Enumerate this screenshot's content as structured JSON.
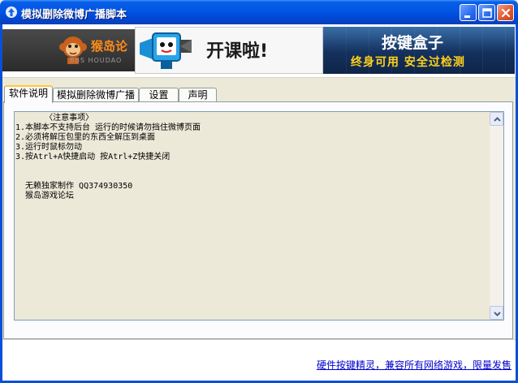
{
  "window": {
    "title": "模拟删除微博广播脚本",
    "icon": "arrow-up-icon",
    "controls": {
      "minimize": "minimize-icon",
      "maximize": "maximize-icon",
      "close": "close-icon"
    }
  },
  "banner": {
    "logo_text": "猴岛论",
    "logo_sub": "BBS HOUDAO",
    "ad_headline": "开课啦!",
    "ad_brand": "按键盒子",
    "ad_tagline": "终身可用  安全过检测"
  },
  "tabs": [
    {
      "label": "软件说明",
      "active": true
    },
    {
      "label": "模拟删除微博广播",
      "active": false
    },
    {
      "label": "设置",
      "active": false
    },
    {
      "label": "声明",
      "active": false
    }
  ],
  "memo": {
    "lines": [
      "      〈注意事项〉",
      "1.本脚本不支持后台 运行的时候请勿挡住微博页面",
      "2.必须将解压包里的东西全解压到桌面",
      "3.运行时鼠标勿动",
      "3.按Atrl+A快捷启动 按Atrl+Z快捷关闭",
      "",
      "",
      "  无赖独家制作 QQ374930350",
      "  猴岛游戏论坛"
    ]
  },
  "footer": {
    "link_text": "硬件按键精灵，兼容所有网络游戏，限量发售"
  },
  "colors": {
    "titlebar": "#0055e5",
    "dialog_bg": "#ece9d8",
    "active_tab_accent": "#ffc83c",
    "ad_tagline": "#ffd21a",
    "link": "#0000cc"
  }
}
